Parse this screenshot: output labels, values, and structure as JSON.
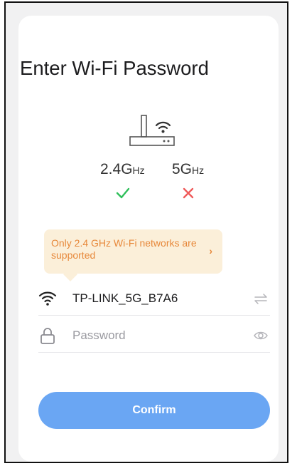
{
  "page": {
    "title": "Enter Wi-Fi Password"
  },
  "bands": [
    {
      "main": "2.4G",
      "unit": "Hz",
      "supported": true
    },
    {
      "main": "5G",
      "unit": "Hz",
      "supported": false
    }
  ],
  "notice": {
    "text": "Only 2.4 GHz Wi-Fi networks are supported",
    "chevron": "›"
  },
  "network": {
    "ssid": "TP-LINK_5G_B7A6",
    "icon": "wifi-icon",
    "switch_icon": "swap-arrows-icon"
  },
  "password": {
    "placeholder": "Password",
    "value": "",
    "icon": "lock-icon",
    "toggle_icon": "eye-icon"
  },
  "confirm": {
    "label": "Confirm"
  },
  "colors": {
    "accent": "#6aa6f3",
    "success": "#2fbf5a",
    "error": "#ef5a5a",
    "notice_bg": "#fbefd9",
    "notice_text": "#e7883a"
  }
}
